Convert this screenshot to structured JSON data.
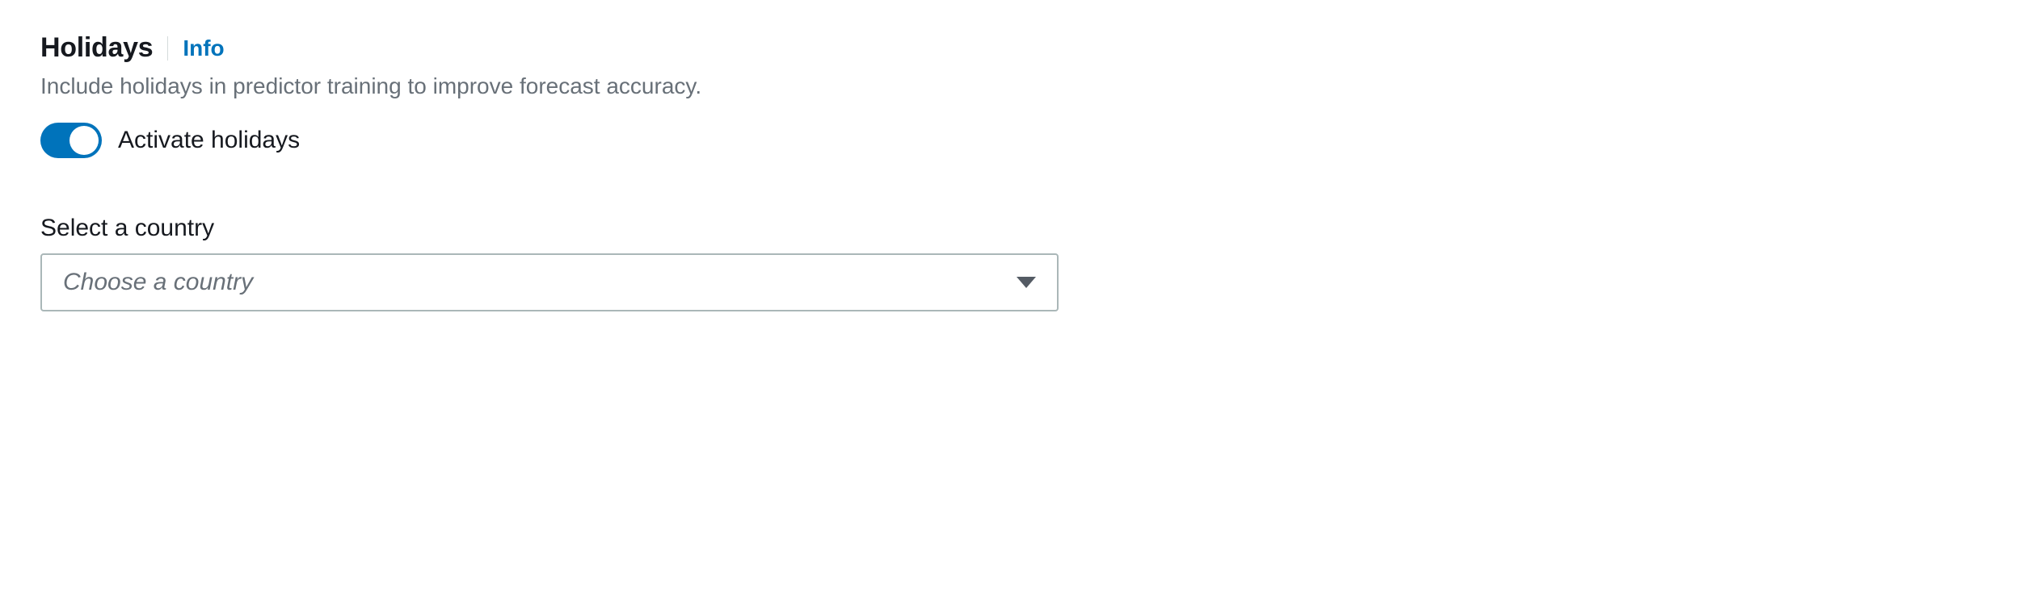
{
  "header": {
    "title": "Holidays",
    "info_label": "Info"
  },
  "description": "Include holidays in predictor training to improve forecast accuracy.",
  "toggle": {
    "label": "Activate holidays",
    "state": "on"
  },
  "country_select": {
    "label": "Select a country",
    "placeholder": "Choose a country",
    "value": ""
  },
  "colors": {
    "accent": "#0073bb",
    "text_primary": "#16191f",
    "text_secondary": "#687078",
    "border": "#aab7b8"
  }
}
